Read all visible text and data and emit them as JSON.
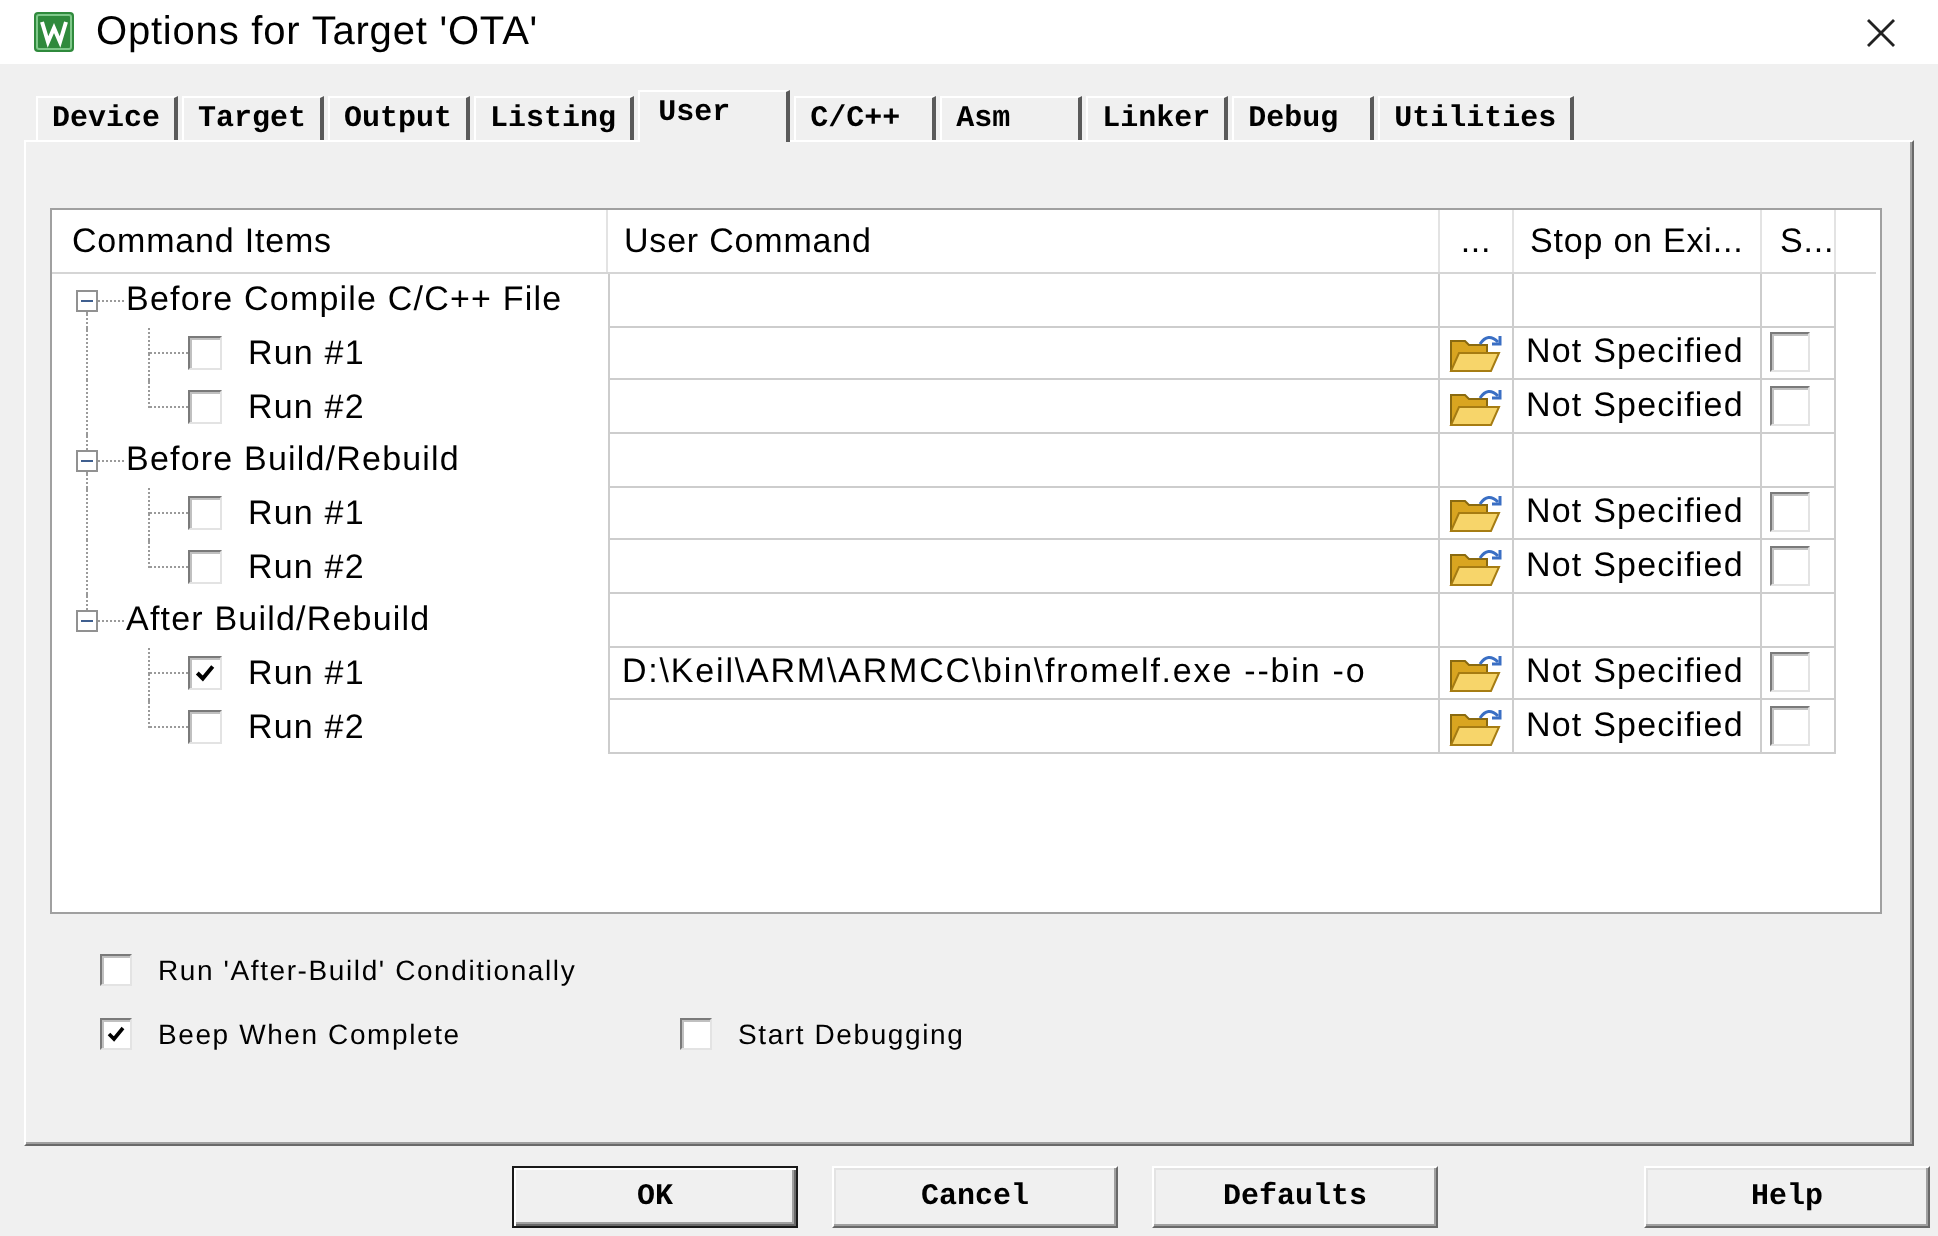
{
  "window": {
    "title": "Options for Target 'OTA'"
  },
  "tabs": [
    {
      "label": "Device",
      "selected": false
    },
    {
      "label": "Target",
      "selected": false
    },
    {
      "label": "Output",
      "selected": false
    },
    {
      "label": "Listing",
      "selected": false
    },
    {
      "label": "User",
      "selected": true
    },
    {
      "label": "C/C++",
      "selected": false
    },
    {
      "label": "Asm",
      "selected": false
    },
    {
      "label": "Linker",
      "selected": false
    },
    {
      "label": "Debug",
      "selected": false
    },
    {
      "label": "Utilities",
      "selected": false
    }
  ],
  "command_table": {
    "columns": [
      "Command Items",
      "User Command",
      "...",
      "Stop on Exi...",
      "S..."
    ],
    "groups": [
      {
        "label": "Before Compile C/C++ File",
        "expanded": true,
        "children": [
          {
            "label": "Run #1",
            "checked": false,
            "column_4": "Not Specified",
            "column_5_checked": false
          },
          {
            "label": "Run #2",
            "checked": false,
            "column_4": "Not Specified",
            "column_5_checked": false
          }
        ]
      },
      {
        "label": "Before Build/Rebuild",
        "expanded": true,
        "children": [
          {
            "label": "Run #1",
            "checked": false,
            "column_4": "Not Specified",
            "column_5_checked": false
          },
          {
            "label": "Run #2",
            "checked": false,
            "column_4": "Not Specified",
            "column_5_checked": false
          }
        ]
      },
      {
        "label": "After Build/Rebuild",
        "expanded": true,
        "children": [
          {
            "label": "Run #1",
            "checked": true,
            "user_command": "D:\\Keil\\ARM\\ARMCC\\bin\\fromelf.exe --bin -o",
            "column_4": "Not Specified",
            "column_5_checked": false
          },
          {
            "label": "Run #2",
            "checked": false,
            "column_4": "Not Specified",
            "column_5_checked": false
          }
        ]
      }
    ]
  },
  "option_rows": [
    {
      "items": [
        {
          "label": "Run 'After-Build' Conditionally",
          "checked": false
        }
      ]
    },
    {
      "items": [
        {
          "label": "Beep When Complete",
          "checked": true
        },
        {
          "label": "Start Debugging",
          "checked": false
        }
      ]
    }
  ],
  "buttons": [
    {
      "label": "OK",
      "default": true
    },
    {
      "label": "Cancel",
      "default": false
    },
    {
      "label": "Defaults",
      "default": false
    },
    {
      "label": "Help",
      "default": false
    }
  ]
}
